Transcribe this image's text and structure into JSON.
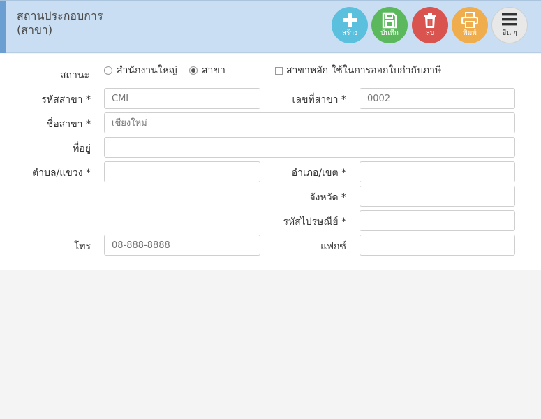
{
  "header": {
    "title_line1": "สถานประกอบการ",
    "title_line2": "(สาขา)",
    "buttons": {
      "create": "สร้าง",
      "save": "บันทึก",
      "delete": "ลบ",
      "print": "พิมพ์",
      "more": "อื่น ๆ"
    },
    "colors": {
      "create": "#5bc0de",
      "save": "#5cb85c",
      "delete": "#d9534f",
      "print": "#f0ad4e",
      "more": "#e8e8e8"
    }
  },
  "form": {
    "status": {
      "label": "สถานะ",
      "options": [
        "สำนักงานใหญ่",
        "สาขา"
      ],
      "selected": "สาขา",
      "main_branch_checkbox_label": "สาขาหลัก ใช้ในการออกใบกำกับภาษี",
      "main_branch_checked": false
    },
    "branch_code": {
      "label": "รหัสสาขา *",
      "placeholder": "CMI"
    },
    "branch_number": {
      "label": "เลขที่สาขา *",
      "placeholder": "0002"
    },
    "branch_name": {
      "label": "ชื่อสาขา *",
      "placeholder": "เชียงใหม่"
    },
    "address": {
      "label": "ที่อยู่",
      "placeholder": ""
    },
    "subdistrict": {
      "label": "ตำบล/แขวง *",
      "placeholder": ""
    },
    "district": {
      "label": "อำเภอ/เขต *",
      "placeholder": ""
    },
    "province": {
      "label": "จังหวัด *",
      "placeholder": ""
    },
    "postal_code": {
      "label": "รหัสไปรษณีย์ *",
      "placeholder": ""
    },
    "phone": {
      "label": "โทร",
      "placeholder": "08-888-8888"
    },
    "fax": {
      "label": "แฟกซ์",
      "placeholder": ""
    }
  }
}
